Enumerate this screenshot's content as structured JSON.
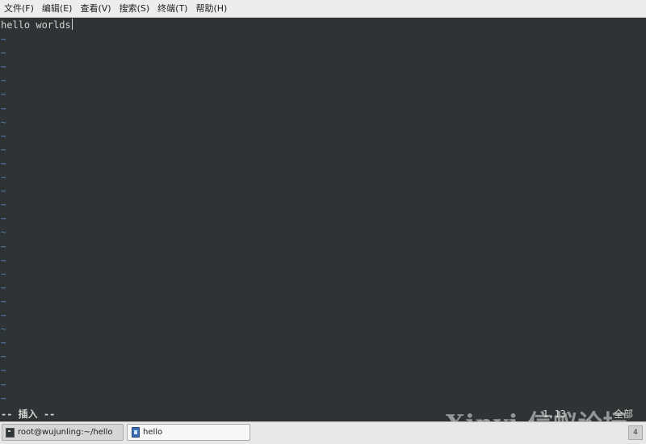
{
  "menubar": {
    "items": [
      {
        "label": "文件(F)"
      },
      {
        "label": "编辑(E)"
      },
      {
        "label": "查看(V)"
      },
      {
        "label": "搜索(S)"
      },
      {
        "label": "终端(T)"
      },
      {
        "label": "帮助(H)"
      }
    ]
  },
  "editor": {
    "content_line": "hello worlds",
    "empty_marker": "~",
    "status_mode": "-- 插入 --",
    "status_position": "1,13",
    "status_percent": "全部"
  },
  "watermark": {
    "text": "Xinyi 信蚁论坛"
  },
  "taskbar": {
    "tasks": [
      {
        "label": "root@wujunling:~/hello"
      },
      {
        "label": "hello"
      }
    ],
    "pager_label": "4"
  },
  "colors": {
    "terminal_bg": "#2e3436",
    "terminal_fg": "#d3d7cf",
    "tilde": "#5c8ad0"
  }
}
